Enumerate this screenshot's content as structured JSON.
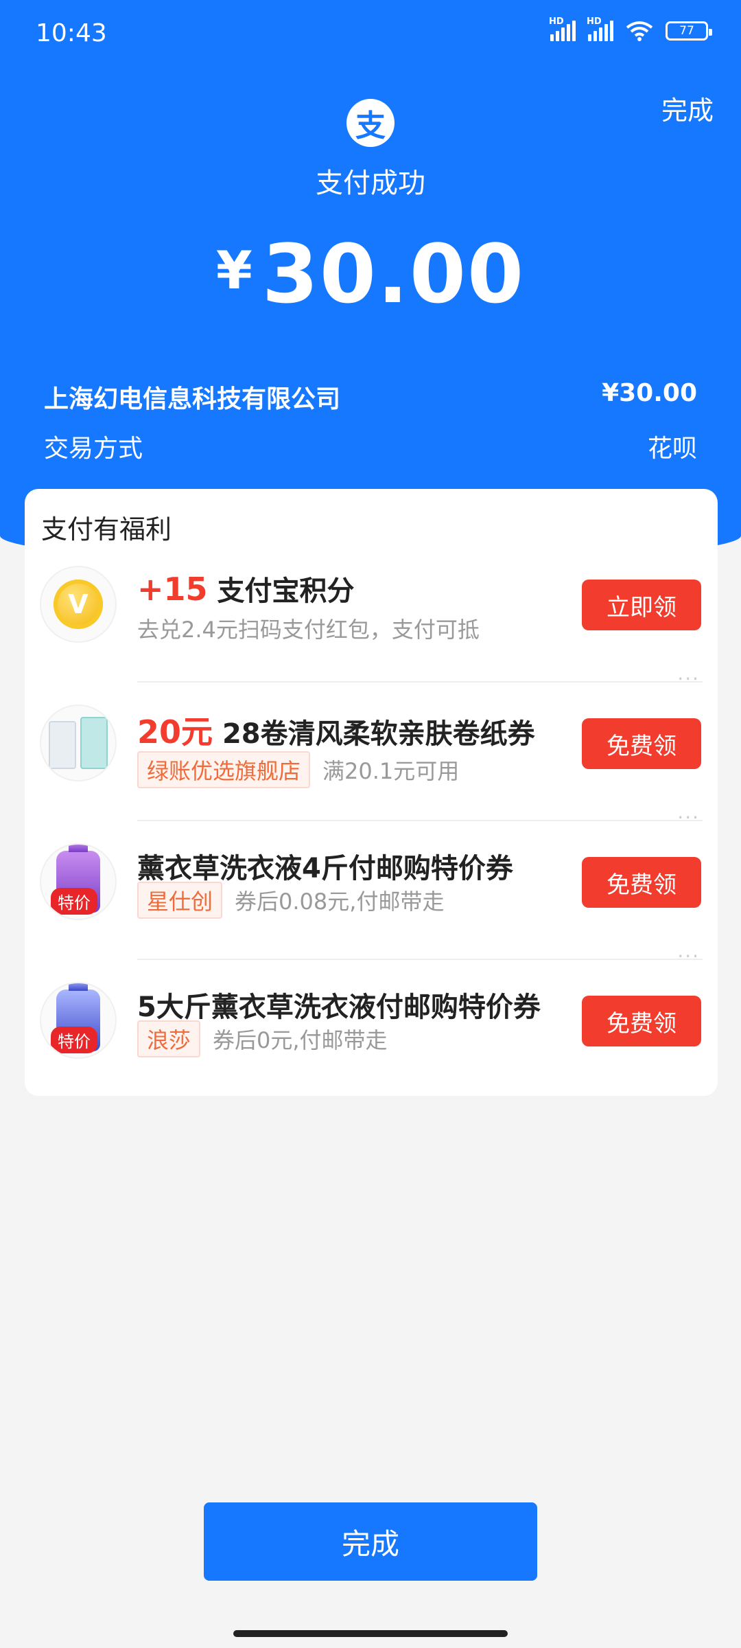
{
  "status": {
    "time": "10:43",
    "battery": "77",
    "signal_tag": "HD"
  },
  "header": {
    "done_label": "完成",
    "logo_glyph": "支",
    "title": "支付成功",
    "currency": "¥",
    "amount": "30.00"
  },
  "details": {
    "merchant": "上海幻电信息科技有限公司",
    "merchant_amount": "¥30.00",
    "method_label": "交易方式",
    "method_value": "花呗"
  },
  "benefits": {
    "title": "支付有福利",
    "items": [
      {
        "icon": "points-coin-icon",
        "highlight": "+15",
        "title": "支付宝积分",
        "desc": "去兑2.4元扫码支付红包，支付可抵",
        "button": "立即领"
      },
      {
        "icon": "tissue-product-icon",
        "highlight": "20元",
        "title": "28卷清风柔软亲肤卷纸券",
        "tag": "绿账优选旗舰店",
        "desc": "满20.1元可用",
        "button": "免费领",
        "more": "···"
      },
      {
        "icon": "detergent-bottle-icon",
        "title": "薰衣草洗衣液4斤付邮购特价券",
        "tag": "星仕创",
        "desc": "券后0.08元,付邮带走",
        "badge": "特价",
        "button": "免费领",
        "more": "···"
      },
      {
        "icon": "detergent-bottle-icon",
        "title": "5大斤薰衣草洗衣液付邮购特价券",
        "tag": "浪莎",
        "desc": "券后0元,付邮带走",
        "badge": "特价",
        "button": "免费领",
        "more": "···"
      }
    ]
  },
  "footer": {
    "done_label": "完成"
  },
  "colors": {
    "brand_blue": "#1677ff",
    "accent_red": "#f23c2e",
    "tag_orange": "#ef6c3a"
  }
}
